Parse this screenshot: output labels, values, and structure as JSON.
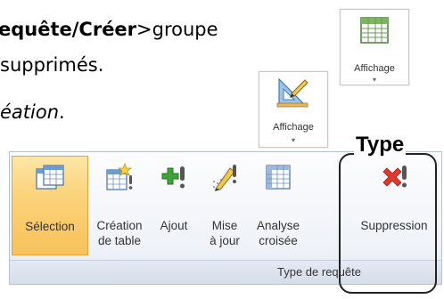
{
  "document": {
    "line1_bold1": "equête",
    "line1_sep": "/",
    "line1_bold2": "Créer",
    "line1_rest": ">groupe",
    "line2": "supprimés.",
    "line3_italic": "éation",
    "line3_rest": "."
  },
  "tiles": {
    "affichage_top": {
      "label": "Affichage",
      "arrow": "▾"
    },
    "affichage_mid": {
      "label": "Affichage",
      "arrow": "▾"
    }
  },
  "callout": {
    "label": "Type"
  },
  "ribbon": {
    "group_label": "Type de requête",
    "buttons": [
      {
        "label_1": "Sélection",
        "label_2": "",
        "icon": "table-select-icon",
        "selected": true
      },
      {
        "label_1": "Création",
        "label_2": "de table",
        "icon": "make-table-icon",
        "selected": false
      },
      {
        "label_1": "Ajout",
        "label_2": "",
        "icon": "append-icon",
        "selected": false
      },
      {
        "label_1": "Mise",
        "label_2": "à jour",
        "icon": "update-icon",
        "selected": false
      },
      {
        "label_1": "Analyse",
        "label_2": "croisée",
        "icon": "crosstab-icon",
        "selected": false
      },
      {
        "label_1": "Suppression",
        "label_2": "",
        "icon": "delete-icon",
        "selected": false
      }
    ]
  },
  "colors": {
    "delete_red": "#e03a2f",
    "append_green": "#3ea33a",
    "selected_orange": "#fbd37a"
  }
}
